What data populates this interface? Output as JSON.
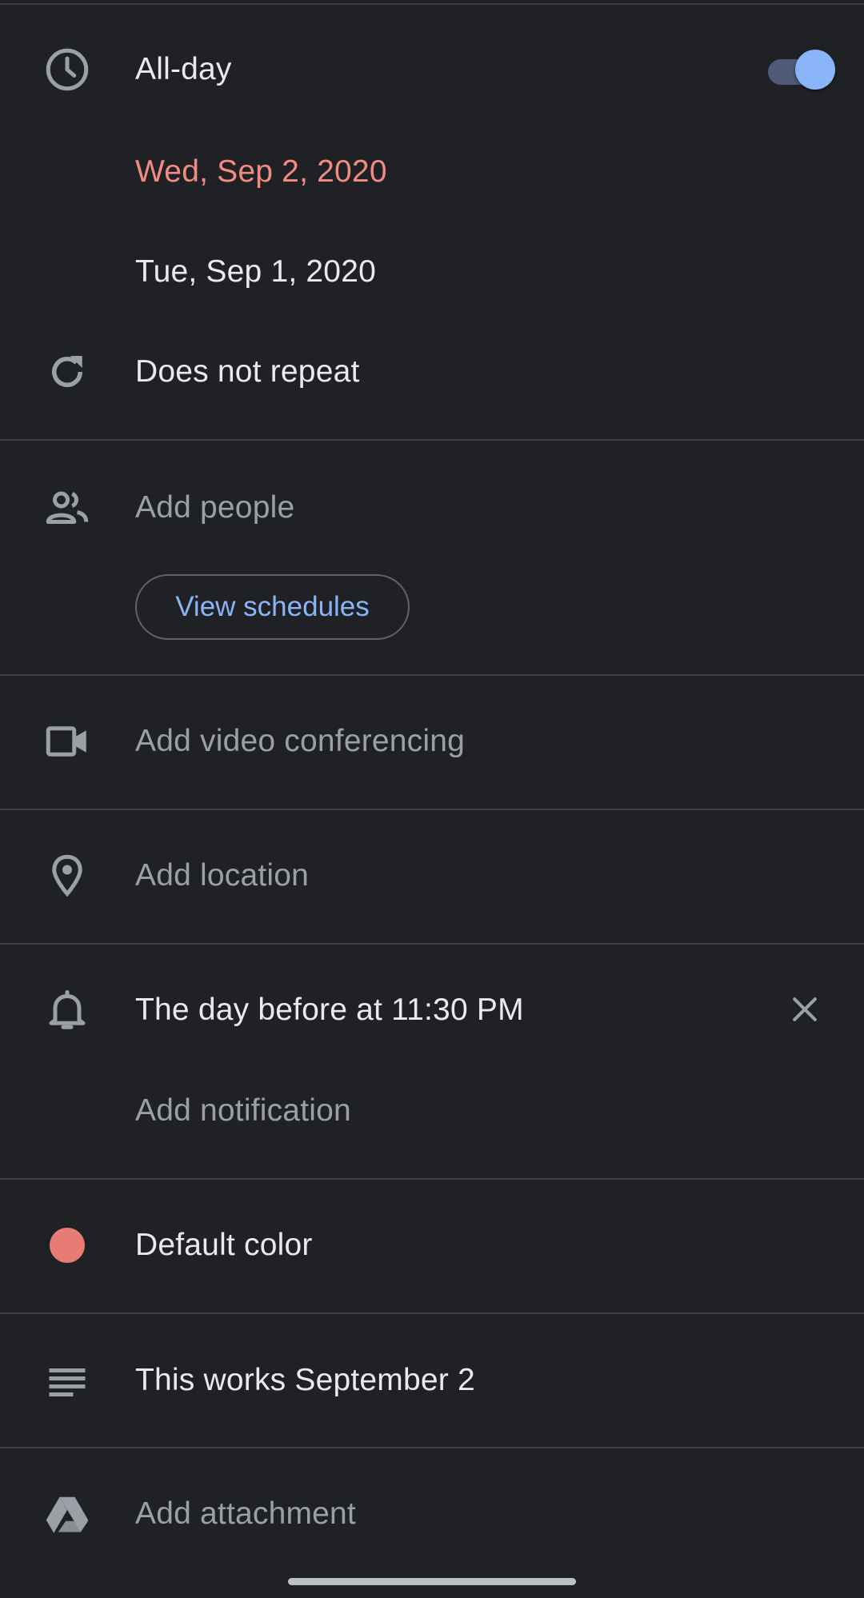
{
  "all_day": {
    "label": "All-day",
    "toggle_on": true,
    "icon": "clock-icon"
  },
  "dates": {
    "start": "Wed, Sep 2, 2020",
    "end": "Tue, Sep 1, 2020"
  },
  "repeat": {
    "label": "Does not repeat",
    "icon": "repeat-icon"
  },
  "people": {
    "placeholder": "Add people",
    "view_schedules_label": "View schedules",
    "icon": "people-icon"
  },
  "video": {
    "placeholder": "Add video conferencing",
    "icon": "videocam-icon"
  },
  "location": {
    "placeholder": "Add location",
    "icon": "location-pin-icon"
  },
  "notifications": {
    "items": [
      "The day before at 11:30 PM"
    ],
    "add_label": "Add notification",
    "icon": "bell-icon"
  },
  "color": {
    "label": "Default color",
    "value": "#e67c73"
  },
  "description": {
    "text": "This works September 2",
    "icon": "notes-icon"
  },
  "attachment": {
    "placeholder": "Add attachment",
    "icon": "drive-icon"
  },
  "colors": {
    "background": "#202124",
    "accent_red": "#f28b82",
    "accent_blue": "#8ab4f8",
    "divider": "#3c4043"
  }
}
